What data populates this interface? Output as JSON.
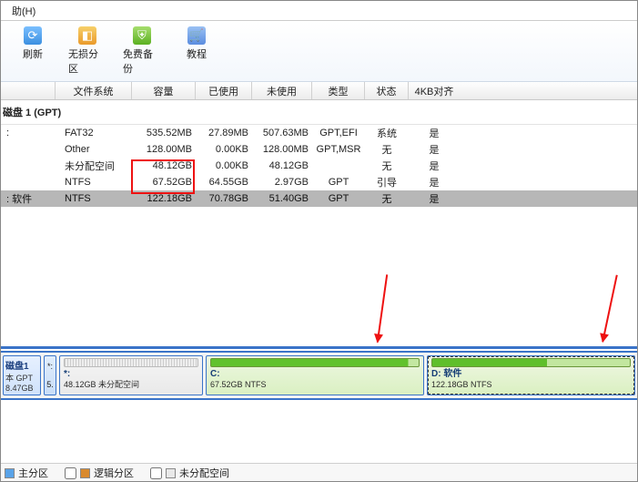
{
  "menu": {
    "help": "助(H)"
  },
  "toolbar": {
    "refresh": "刷新",
    "lossless": "无损分区",
    "backup": "免费备份",
    "tutorial": "教程"
  },
  "headers": {
    "filesystem": "文件系统",
    "capacity": "容量",
    "used": "已使用",
    "free": "未使用",
    "type": "类型",
    "status": "状态",
    "align": "4KB对齐"
  },
  "disk_title": "磁盘 1 (GPT)",
  "rows": [
    {
      "name": ":",
      "fs": "FAT32",
      "cap": "535.52MB",
      "used": "27.89MB",
      "free": "507.63MB",
      "type": "GPT,EFI",
      "status": "系统",
      "align": "是"
    },
    {
      "name": "",
      "fs": "Other",
      "cap": "128.00MB",
      "used": "0.00KB",
      "free": "128.00MB",
      "type": "GPT,MSR",
      "status": "无",
      "align": "是"
    },
    {
      "name": "",
      "fs": "未分配空间",
      "cap": "48.12GB",
      "used": "0.00KB",
      "free": "48.12GB",
      "type": "",
      "status": "无",
      "align": "是"
    },
    {
      "name": "",
      "fs": "NTFS",
      "cap": "67.52GB",
      "used": "64.55GB",
      "free": "2.97GB",
      "type": "GPT",
      "status": "引导",
      "align": "是"
    },
    {
      "name": ": 软件",
      "fs": "NTFS",
      "cap": "122.18GB",
      "used": "70.78GB",
      "free": "51.40GB",
      "type": "GPT",
      "status": "无",
      "align": "是"
    }
  ],
  "diskbar": {
    "summary": {
      "name": "磁盘1",
      "line1": "本 GPT",
      "line2": "8.47GB"
    },
    "tiny": {
      "top": "*:",
      "bot": "5."
    },
    "unalloc": {
      "title": "*:",
      "sub": "48.12GB 未分配空间"
    },
    "c": {
      "title": "C:",
      "sub": "67.52GB NTFS"
    },
    "d": {
      "title": "D: 软件",
      "sub": "122.18GB NTFS"
    }
  },
  "legend": {
    "primary": "主分区",
    "logical": "逻辑分区",
    "unalloc": "未分配空间"
  }
}
